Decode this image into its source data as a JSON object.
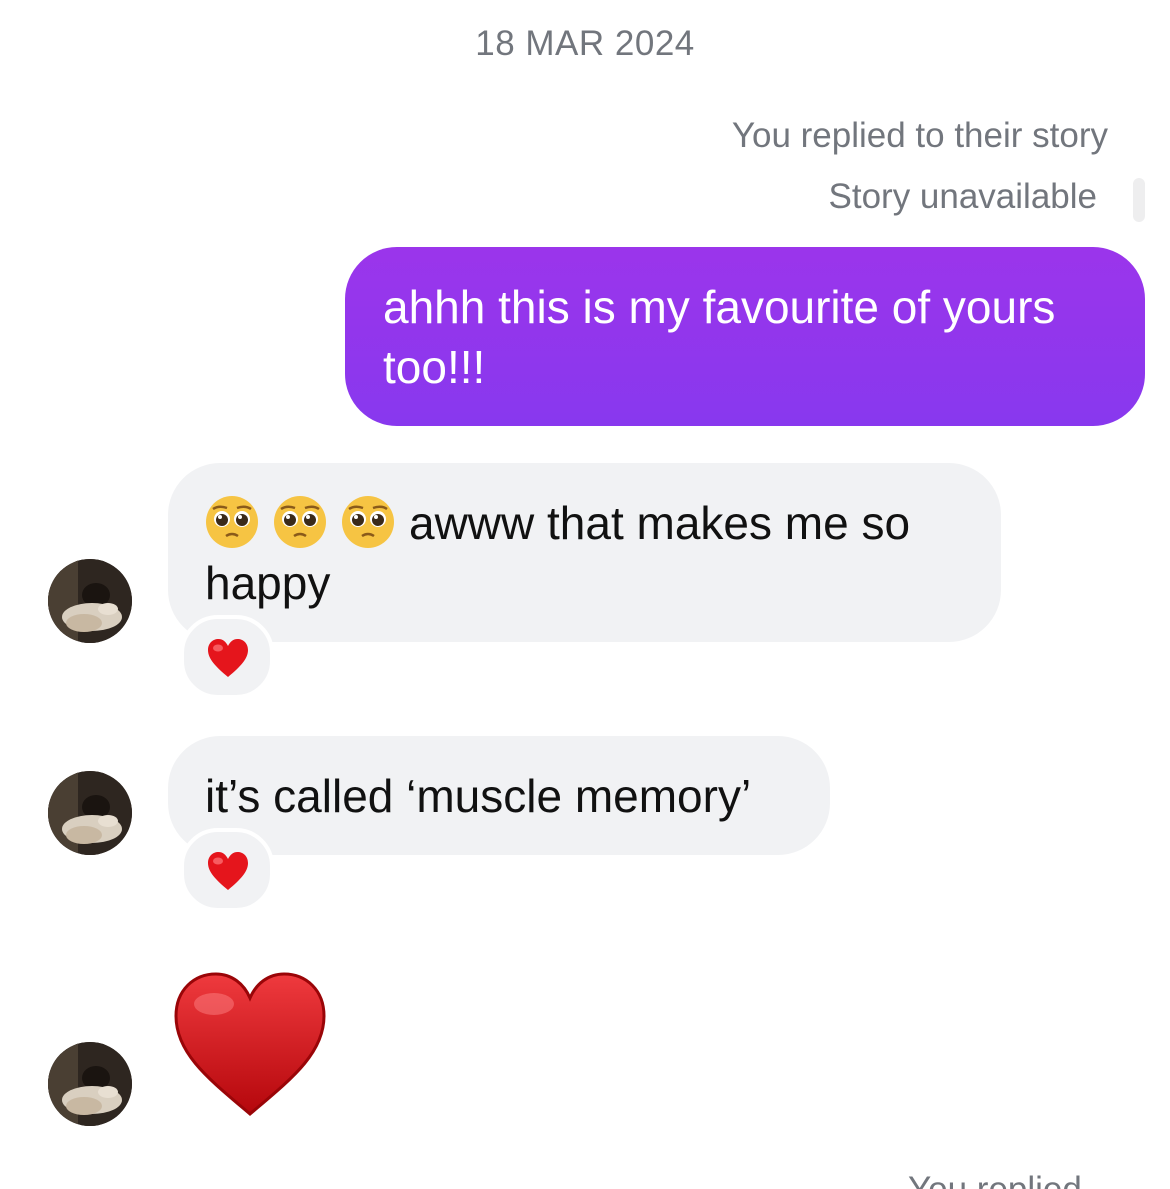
{
  "thread": {
    "date": "18 MAR 2024",
    "story_reply": {
      "caption": "You replied to their story",
      "status": "Story unavailable"
    },
    "messages": [
      {
        "sender": "me",
        "text": "ahhh this is my favourite of yours too!!!"
      },
      {
        "sender": "them",
        "emojis": [
          "pleading-face-emoji",
          "pleading-face-emoji",
          "pleading-face-emoji"
        ],
        "text": "awww that makes me so happy",
        "reaction": "red-heart-emoji"
      },
      {
        "sender": "them",
        "text": "it’s called ‘muscle memory’",
        "reaction": "red-heart-emoji"
      },
      {
        "sender": "them",
        "sticker": "red-heart-emoji"
      }
    ],
    "footer_caption": "You replied"
  },
  "colors": {
    "outgoing_bubble": "#8f37ec",
    "incoming_bubble": "#f1f2f4",
    "meta_text": "#72767d",
    "heart": "#d8161b"
  }
}
